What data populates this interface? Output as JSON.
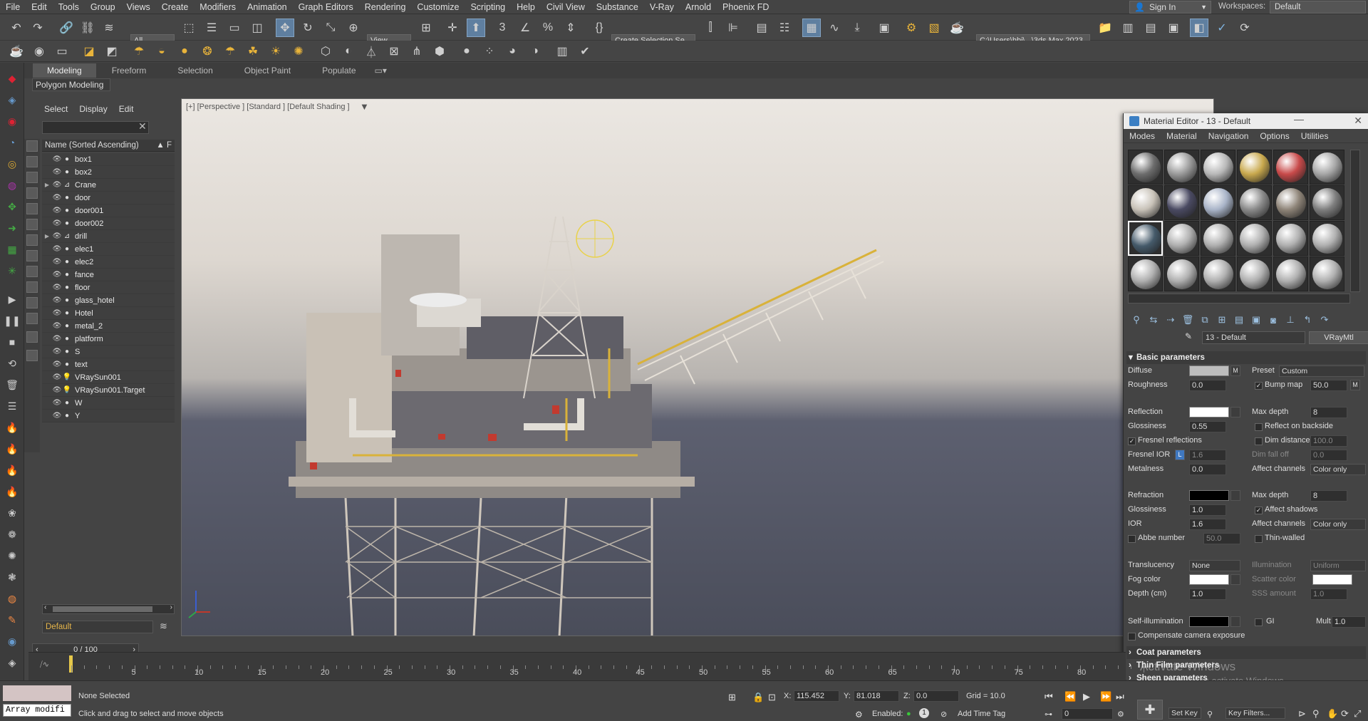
{
  "menubar": {
    "items": [
      "File",
      "Edit",
      "Tools",
      "Group",
      "Views",
      "Create",
      "Modifiers",
      "Animation",
      "Graph Editors",
      "Rendering",
      "Customize",
      "Scripting",
      "Help",
      "Civil View",
      "Substance",
      "V-Ray",
      "Arnold",
      "Phoenix FD"
    ],
    "signin": "Sign In",
    "workspaces_label": "Workspaces:",
    "workspaces_value": "Default"
  },
  "toolbar": {
    "filter_value": "All",
    "view_value": "View",
    "selection_set": "Create Selection Se",
    "path_value": "C:\\Users\\hbi\\...\\3ds Max 2023"
  },
  "ribbon": {
    "tabs": [
      "Modeling",
      "Freeform",
      "Selection",
      "Object Paint",
      "Populate"
    ],
    "panel_label": "Polygon Modeling"
  },
  "scene_explorer": {
    "menu": [
      "Select",
      "Display",
      "Edit"
    ],
    "header": "Name (Sorted Ascending)",
    "sort_indicator": "▲ F",
    "objects": [
      {
        "name": "box1",
        "type": "obj",
        "expandable": false
      },
      {
        "name": "box2",
        "type": "obj",
        "expandable": false
      },
      {
        "name": "Crane",
        "type": "bone",
        "expandable": true
      },
      {
        "name": "door",
        "type": "obj",
        "expandable": false
      },
      {
        "name": "door001",
        "type": "obj",
        "expandable": false
      },
      {
        "name": "door002",
        "type": "obj",
        "expandable": false
      },
      {
        "name": "drill",
        "type": "bone",
        "expandable": true
      },
      {
        "name": "elec1",
        "type": "obj",
        "expandable": false
      },
      {
        "name": "elec2",
        "type": "obj",
        "expandable": false
      },
      {
        "name": "fance",
        "type": "obj",
        "expandable": false
      },
      {
        "name": "floor",
        "type": "obj",
        "expandable": false
      },
      {
        "name": "glass_hotel",
        "type": "obj",
        "expandable": false
      },
      {
        "name": "Hotel",
        "type": "obj",
        "expandable": false
      },
      {
        "name": "metal_2",
        "type": "obj",
        "expandable": false
      },
      {
        "name": "platform",
        "type": "obj",
        "expandable": false
      },
      {
        "name": "S",
        "type": "obj",
        "expandable": false
      },
      {
        "name": "text",
        "type": "obj",
        "expandable": false
      },
      {
        "name": "VRaySun001",
        "type": "light",
        "expandable": false
      },
      {
        "name": "VRaySun001.Target",
        "type": "light",
        "expandable": false
      },
      {
        "name": "W",
        "type": "obj",
        "expandable": false
      },
      {
        "name": "Y",
        "type": "obj",
        "expandable": false
      }
    ],
    "layer": "Default",
    "time_slider": "0 / 100"
  },
  "viewport": {
    "label": "[+] [Perspective ] [Standard ] [Default Shading ]"
  },
  "material_editor": {
    "title": "Material Editor - 13 - Default",
    "menu": [
      "Modes",
      "Material",
      "Navigation",
      "Options",
      "Utilities"
    ],
    "material_name": "13 - Default",
    "material_type": "VRayMtl",
    "sections": {
      "basic": "Basic parameters",
      "coat": "Coat parameters",
      "thin_film": "Thin Film parameters",
      "sheen": "Sheen parameters"
    },
    "params": {
      "diffuse": "Diffuse",
      "preset_label": "Preset",
      "preset_value": "Custom",
      "roughness_label": "Roughness",
      "roughness": "0.0",
      "bump_label": "Bump map",
      "bump": "50.0",
      "reflection": "Reflection",
      "max_depth_label": "Max depth",
      "refl_max_depth": "8",
      "glossiness_label": "Glossiness",
      "refl_glossiness": "0.55",
      "reflect_backside": "Reflect on backside",
      "fresnel_reflections": "Fresnel reflections",
      "dim_distance_label": "Dim distance",
      "dim_distance": "100.0",
      "fresnel_ior_label": "Fresnel IOR",
      "fresnel_ior": "1.6",
      "dim_falloff_label": "Dim fall off",
      "dim_falloff": "0.0",
      "metalness_label": "Metalness",
      "metalness": "0.0",
      "affect_channels_label": "Affect channels",
      "refl_affect_channels": "Color only",
      "refraction": "Refraction",
      "refr_max_depth": "8",
      "refr_glossiness": "1.0",
      "affect_shadows": "Affect shadows",
      "ior_label": "IOR",
      "ior": "1.6",
      "refr_affect_channels": "Color only",
      "abbe_label": "Abbe number",
      "abbe": "50.0",
      "thin_walled": "Thin-walled",
      "translucency_label": "Translucency",
      "translucency": "None",
      "illumination_label": "Illumination",
      "illumination": "Uniform",
      "fog_color": "Fog color",
      "scatter_color": "Scatter color",
      "depth_label": "Depth (cm)",
      "depth": "1.0",
      "sss_label": "SSS amount",
      "sss": "1.0",
      "self_illum": "Self-illumination",
      "gi": "GI",
      "mult_label": "Mult",
      "mult": "1.0",
      "compensate": "Compensate camera exposure"
    }
  },
  "watermark": {
    "line1": "Activate Windows",
    "line2": "Go to Settings to activate Windows."
  },
  "timeline": {
    "labels": [
      "5",
      "10",
      "15",
      "20",
      "25",
      "30",
      "35",
      "40",
      "45",
      "50",
      "55",
      "60",
      "65",
      "70",
      "75",
      "80"
    ]
  },
  "statusbar": {
    "maxscript": "Array modifi",
    "selection": "None Selected",
    "prompt": "Click and drag to select and move objects",
    "x_label": "X:",
    "x": "115.452",
    "y_label": "Y:",
    "y": "81.018",
    "z_label": "Z:",
    "z": "0.0",
    "grid": "Grid = 10.0",
    "enabled_label": "Enabled:",
    "add_time_tag": "Add Time Tag",
    "frame": "0",
    "set_key": "Set Key",
    "key_filters": "Key Filters..."
  },
  "colors": {
    "accent": "#5f7fa0",
    "icon_yellow": "#e9b43a",
    "layer_text": "#e6b54a",
    "viewport_sky": "#ebe7e2",
    "viewport_sea": "#4a4d5a"
  }
}
